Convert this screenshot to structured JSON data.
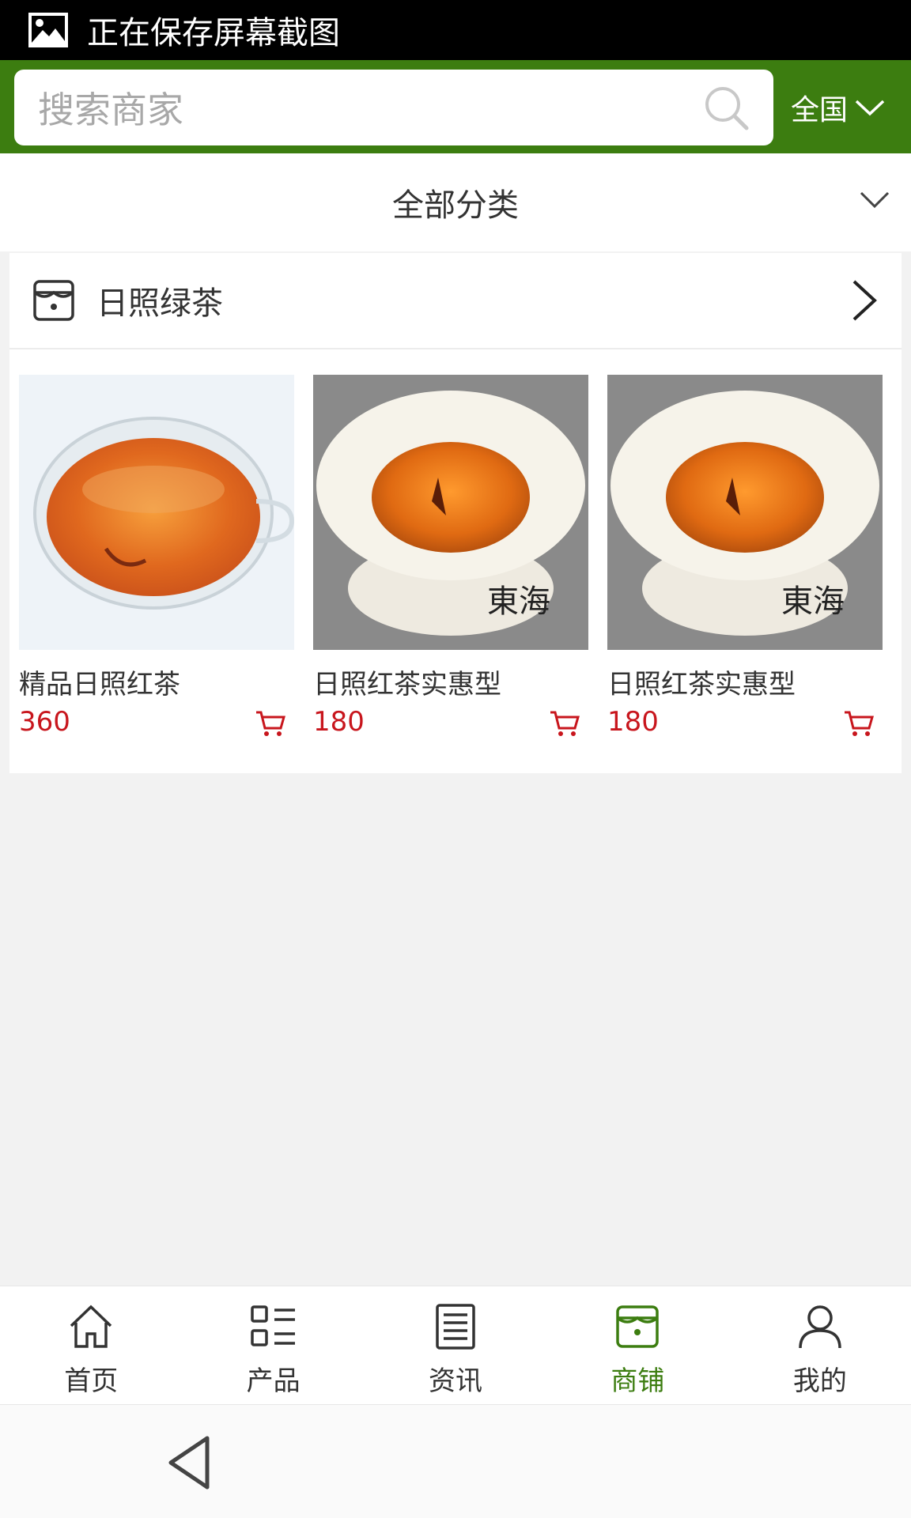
{
  "status_bar": {
    "text": "正在保存屏幕截图"
  },
  "header": {
    "search_placeholder": "搜索商家",
    "region_label": "全国"
  },
  "category": {
    "label": "全部分类"
  },
  "store": {
    "name": "日照绿茶",
    "products": [
      {
        "name": "精品日照红茶",
        "price": "360"
      },
      {
        "name": "日照红茶实惠型",
        "price": "180"
      },
      {
        "name": "日照红茶实惠型",
        "price": "180"
      }
    ]
  },
  "tabbar": {
    "items": [
      {
        "label": "首页",
        "icon": "home-icon"
      },
      {
        "label": "产品",
        "icon": "grid-list-icon"
      },
      {
        "label": "资讯",
        "icon": "news-icon"
      },
      {
        "label": "商铺",
        "icon": "store-icon",
        "active": true
      },
      {
        "label": "我的",
        "icon": "user-icon"
      }
    ]
  },
  "colors": {
    "brand_green": "#3c7d10",
    "price_red": "#c8161d"
  }
}
